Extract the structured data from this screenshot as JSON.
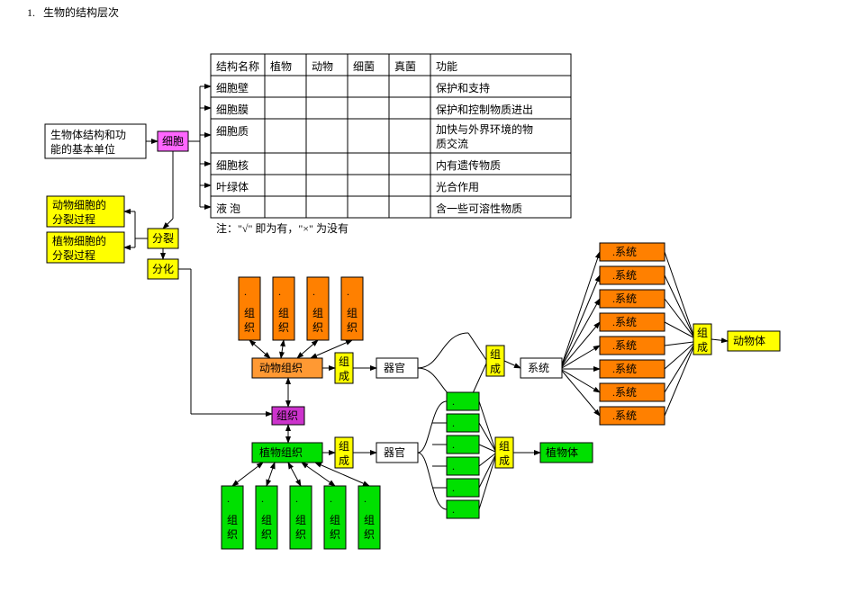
{
  "title_num": "1.",
  "title": "生物的结构层次",
  "basic_unit": "生物体结构和功能的基本单位",
  "cell": "细胞",
  "split": "分裂",
  "diff": "分化",
  "animal_split": "动物细胞的分裂过程",
  "plant_split": "植物细胞的分裂过程",
  "table": {
    "headers": [
      "结构名称",
      "植物",
      "动物",
      "细菌",
      "真菌",
      "功能"
    ],
    "rows": [
      {
        "name": "细胞壁",
        "plant": "",
        "animal": "",
        "bacteria": "",
        "fungi": "",
        "func": "保护和支持"
      },
      {
        "name": "细胞膜",
        "plant": "",
        "animal": "",
        "bacteria": "",
        "fungi": "",
        "func": "保护和控制物质进出"
      },
      {
        "name": "细胞质",
        "plant": "",
        "animal": "",
        "bacteria": "",
        "fungi": "",
        "func": "加快与外界环境的物质交流"
      },
      {
        "name": "细胞核",
        "plant": "",
        "animal": "",
        "bacteria": "",
        "fungi": "",
        "func": "内有遗传物质"
      },
      {
        "name": "叶绿体",
        "plant": "",
        "animal": "",
        "bacteria": "",
        "fungi": "",
        "func": "光合作用"
      },
      {
        "name": "液  泡",
        "plant": "",
        "animal": "",
        "bacteria": "",
        "fungi": "",
        "func": "含一些可溶性物质"
      }
    ],
    "note": "注：\"√\" 即为有，\"×\" 为没有"
  },
  "tissue": "组织",
  "animal_tissue": "动物组织",
  "plant_tissue": "植物组织",
  "tissue_item": "组织",
  "compose": "组成",
  "organ": "器官",
  "system": "系统",
  "system_item": ".系统",
  "animal_body": "动物体",
  "plant_body": "植物体",
  "dot": "."
}
